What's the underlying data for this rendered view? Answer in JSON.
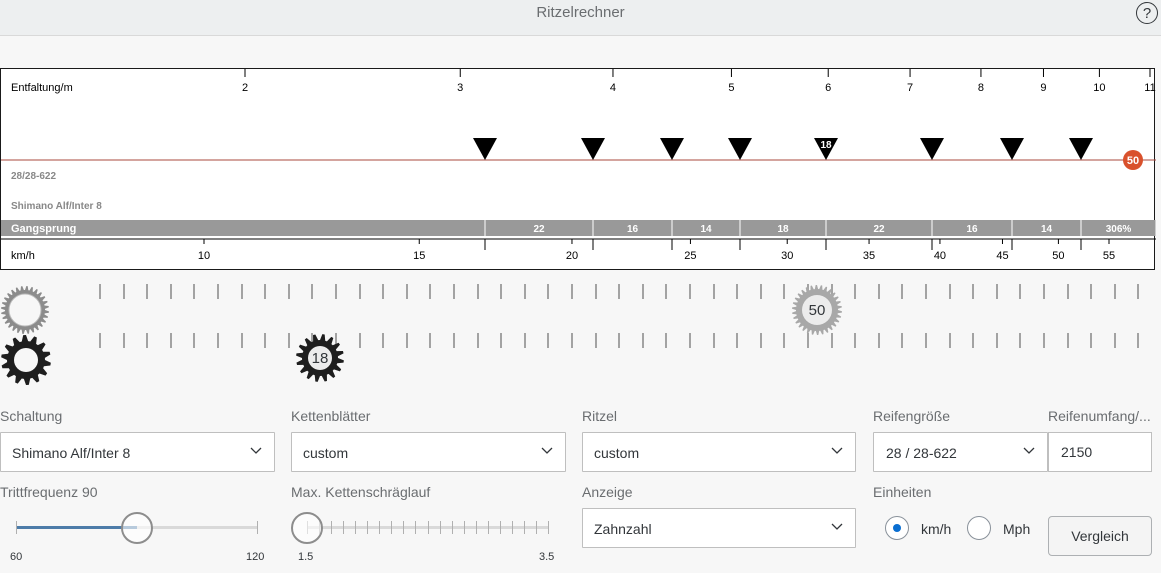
{
  "app": {
    "title": "Ritzelrechner",
    "help_label": "?"
  },
  "chart": {
    "top_axis_label": "Entfaltung/m",
    "top_ticks": [
      "2",
      "3",
      "4",
      "5",
      "6",
      "7",
      "8",
      "9",
      "10",
      "11"
    ],
    "gear_markers": [
      "",
      "",
      "",
      "",
      "18",
      "",
      "",
      ""
    ],
    "chainring_badge": "50",
    "info_line1": "28/28-622",
    "info_line2": "Shimano Alf/Inter 8",
    "gangsprung_label": "Gangsprung",
    "gangsprung_values": [
      "22",
      "16",
      "14",
      "18",
      "22",
      "16",
      "14",
      "306%"
    ],
    "bottom_axis_label": "km/h",
    "bottom_ticks": [
      "10",
      "15",
      "20",
      "25",
      "30",
      "35",
      "40",
      "45",
      "50",
      "55"
    ]
  },
  "gears": {
    "chainring_label": "50",
    "sprocket_label": "18"
  },
  "form": {
    "schaltung": {
      "label": "Schaltung",
      "value": "Shimano Alf/Inter 8"
    },
    "kettenblaetter": {
      "label": "Kettenblätter",
      "value": "custom"
    },
    "ritzel": {
      "label": "Ritzel",
      "value": "custom"
    },
    "reifengroesse": {
      "label": "Reifengröße",
      "value": "28 / 28-622"
    },
    "reifenumfang": {
      "label": "Reifenumfang/...",
      "value": "2150"
    },
    "trittfrequenz": {
      "label": "Trittfrequenz 90",
      "min": "60",
      "max": "120",
      "value": 90
    },
    "kettenschraeglauf": {
      "label": "Max. Kettenschräglauf",
      "min": "1.5",
      "max": "3.5",
      "value": 1.5
    },
    "anzeige": {
      "label": "Anzeige",
      "value": "Zahnzahl"
    },
    "einheiten": {
      "label": "Einheiten",
      "option_kmh": "km/h",
      "option_mph": "Mph",
      "selected": "km/h"
    },
    "vergleich_label": "Vergleich"
  },
  "colors": {
    "accent": "#0a6ed1",
    "chain_line": "#a94a3e",
    "badge": "#d9512c",
    "gangsprung_bar": "#999999",
    "slider_fill": "#4d7ca9"
  }
}
